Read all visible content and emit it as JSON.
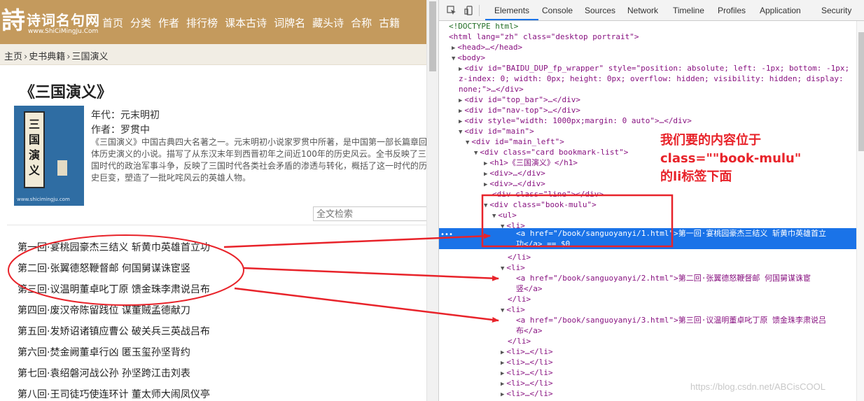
{
  "site": {
    "logo_mark": "詩",
    "logo_text": "诗词名句网",
    "logo_url": "www.ShiCiMingJu.Com",
    "nav": [
      "首页",
      "分类",
      "作者",
      "排行榜",
      "课本古诗",
      "词牌名",
      "藏头诗",
      "合称",
      "古籍"
    ]
  },
  "breadcrumb": [
    "主页",
    "史书典籍",
    "三国演义"
  ],
  "book": {
    "title": "《三国演义》",
    "cover_title": "三国演义",
    "cover_url": "www.shicimingju.com",
    "era": "年代：元末明初",
    "author": "作者：罗贯中",
    "description": "《三国演义》中国古典四大名著之一。元末明初小说家罗贯中所著，是中国第一部长篇章回体历史演义的小说。描写了从东汉末年到西晋初年之间近100年的历史风云。全书反映了三国时代的政治军事斗争，反映了三国时代各类社会矛盾的渗透与转化，概括了这一时代的历史巨变，塑造了一批叱咤风云的英雄人物。",
    "search_placeholder": "全文检索"
  },
  "chapters": [
    "第一回·宴桃园豪杰三结义 斩黄巾英雄首立功",
    "第二回·张翼德怒鞭督邮 何国舅谋诛宦竖",
    "第三回·议温明董卓叱丁原 馈金珠李肃说吕布",
    "第四回·废汉帝陈留践位 谋董贼孟德献刀",
    "第五回·发矫诏诸镇应曹公 破关兵三英战吕布",
    "第六回·焚金阙董卓行凶 匿玉玺孙坚背约",
    "第七回·袁绍磐河战公孙 孙坚跨江击刘表",
    "第八回·王司徒巧使连环计 董太师大闹凤仪亭"
  ],
  "devtools": {
    "tabs": [
      "Elements",
      "Console",
      "Sources",
      "Network",
      "Timeline",
      "Profiles",
      "Application",
      "Security"
    ],
    "active_tab": "Elements",
    "ln": {
      "doctype": "<!DOCTYPE html>",
      "html_open": "<html lang=\"zh\" class=\"desktop portrait\">",
      "head": "<head>…</head>",
      "body": "<body>",
      "baidu_1": "<div id=\"BAIDU_DUP_fp_wrapper\" style=\"position: absolute; left: -1px; bottom: -1px;",
      "baidu_2": "z-index: 0; width: 0px; height: 0px; overflow: hidden; visibility: hidden; display:",
      "baidu_3": "none;\">…</div>",
      "top_bar": "<div id=\"top_bar\">…</div>",
      "nav_top": "<div id=\"nav-top\">…</div>",
      "style_div": "<div style=\"width: 1000px;margin: 0 auto\">…</div>",
      "main": "<div id=\"main\">",
      "main_left": "<div id=\"main_left\">",
      "card": "<div class=\"card bookmark-list\">",
      "h1": "<h1>《三国演义》</h1>",
      "div1": "<div>…</div>",
      "div2": "<div>…</div>",
      "line": "<div class=\"line\"></div>",
      "mulu": "<div class=\"book-mulu\">",
      "ul": "<ul>",
      "li1": "<li>",
      "a1": "<a href=\"/book/sanguoyanyi/1.html\">第一回·宴桃园豪杰三结义  斩黄巾英雄首立",
      "a1b": "功</a> == $0",
      "li1_close": "</li>",
      "li2": "<li>",
      "a2": "<a href=\"/book/sanguoyanyi/2.html\">第二回·张翼德怒鞭督邮   何国舅谋诛宦",
      "a2b": "竖</a>",
      "li2_close": "</li>",
      "li3": "<li>",
      "a3": "<a href=\"/book/sanguoyanyi/3.html\">第三回·议温明董卓叱丁原  馈金珠李肃说吕",
      "a3b": "布</a>",
      "li3_close": "</li>",
      "li_collapsed": "<li>…</li>",
      "li_partial": "<li>…</li>"
    }
  },
  "annotation": {
    "note_line1": "我们要的内容位于",
    "note_line2": "class=\"\"book-mulu\"",
    "note_line3": "的li标签下面",
    "color": "#e8232a"
  },
  "watermark": "https://blog.csdn.net/ABCisCOOL"
}
